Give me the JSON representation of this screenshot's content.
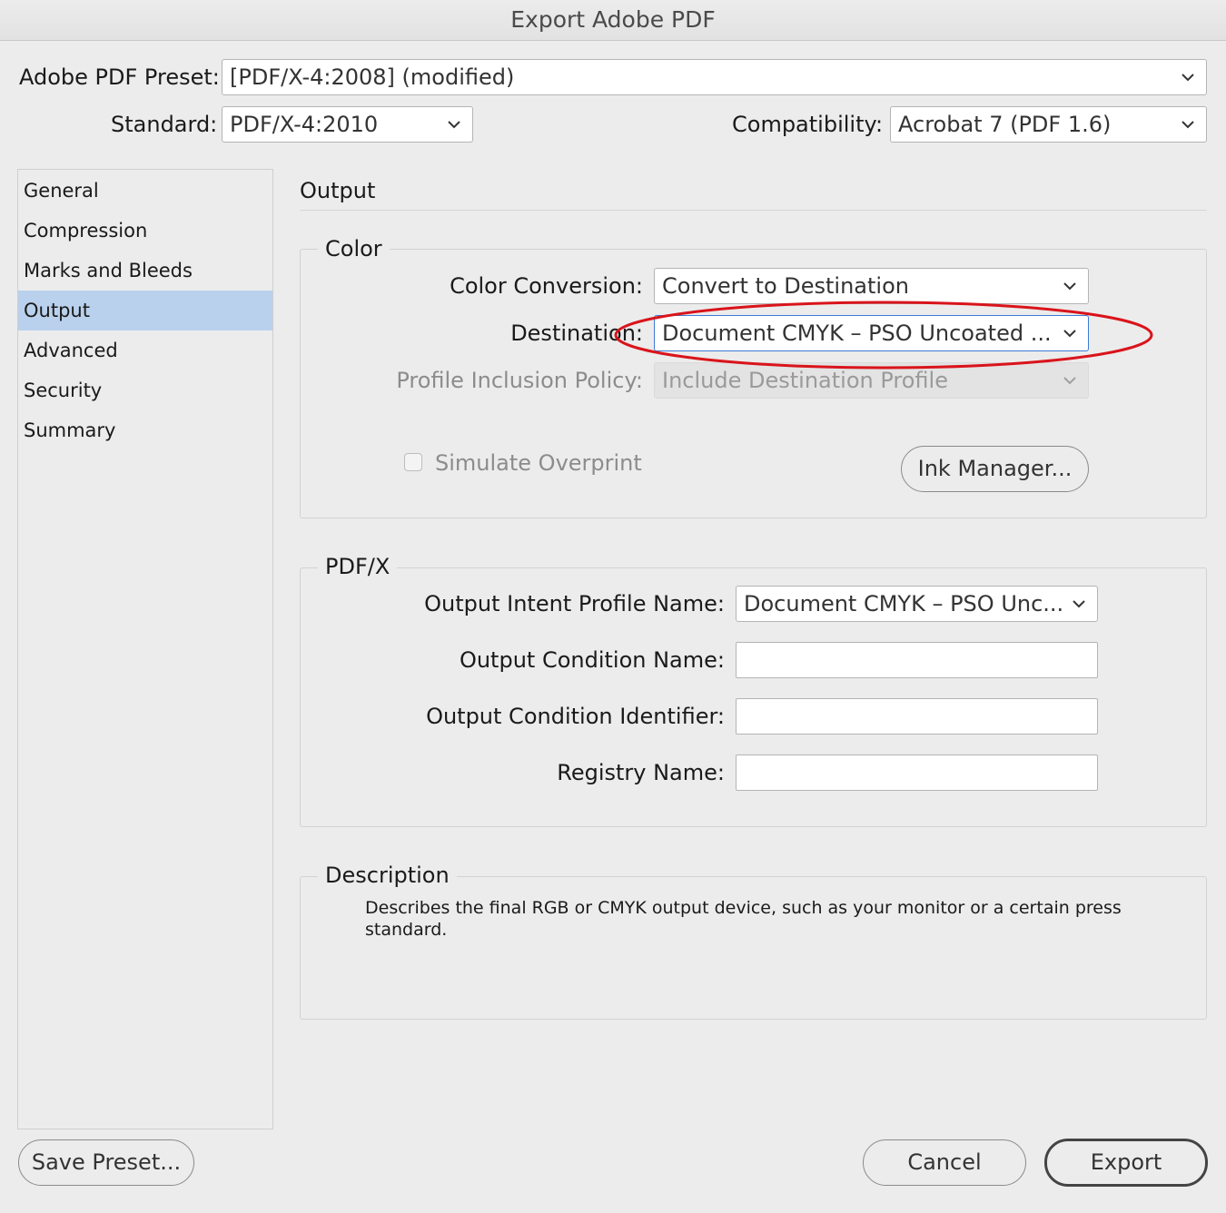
{
  "window": {
    "title": "Export Adobe PDF"
  },
  "preset": {
    "label": "Adobe PDF Preset:",
    "value": "[PDF/X-4:2008] (modified)"
  },
  "standard": {
    "label": "Standard:",
    "value": "PDF/X-4:2010"
  },
  "compatibility": {
    "label": "Compatibility:",
    "value": "Acrobat 7 (PDF 1.6)"
  },
  "sidebar": {
    "selected": "Output",
    "items": [
      {
        "label": "General"
      },
      {
        "label": "Compression"
      },
      {
        "label": "Marks and Bleeds"
      },
      {
        "label": "Output"
      },
      {
        "label": "Advanced"
      },
      {
        "label": "Security"
      },
      {
        "label": "Summary"
      }
    ]
  },
  "main": {
    "title": "Output",
    "color": {
      "title": "Color",
      "conversion": {
        "label": "Color Conversion:",
        "value": "Convert to Destination"
      },
      "destination": {
        "label": "Destination:",
        "value": "Document CMYK – PSO Uncoated ..."
      },
      "profile_policy": {
        "label": "Profile Inclusion Policy:",
        "value": "Include Destination Profile",
        "enabled": false
      },
      "simulate_overprint": {
        "label": "Simulate Overprint",
        "checked": false,
        "enabled": false
      },
      "ink_manager_label": "Ink Manager..."
    },
    "pdfx": {
      "title": "PDF/X",
      "output_intent": {
        "label": "Output Intent Profile Name:",
        "value": "Document CMYK – PSO Unc..."
      },
      "output_condition_name": {
        "label": "Output Condition Name:",
        "value": ""
      },
      "output_condition_identifier": {
        "label": "Output Condition Identifier:",
        "value": ""
      },
      "registry_name": {
        "label": "Registry Name:",
        "value": ""
      }
    },
    "description": {
      "title": "Description",
      "text": "Describes the final RGB or CMYK output device, such as your monitor or a certain press standard."
    }
  },
  "footer": {
    "save_preset_label": "Save Preset...",
    "cancel_label": "Cancel",
    "export_label": "Export"
  },
  "colors": {
    "selection_bg": "#b9d1ec",
    "focus_border": "#3b7bd6",
    "annotation_ellipse": "#d9141b"
  }
}
